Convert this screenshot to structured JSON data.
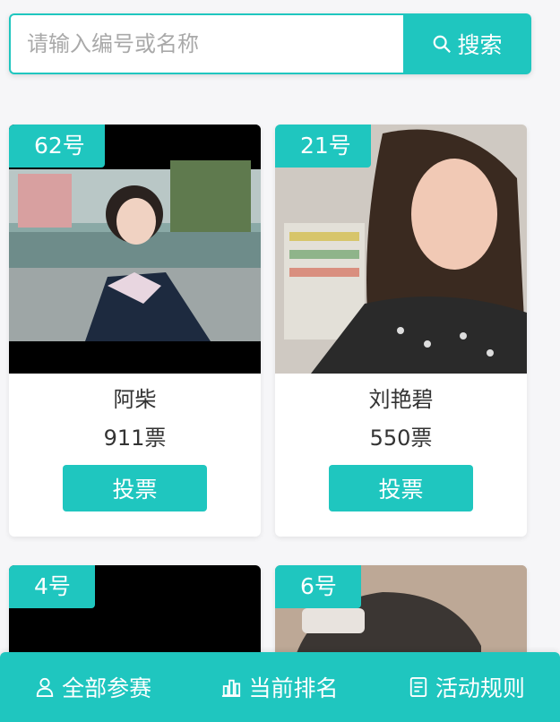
{
  "search": {
    "placeholder": "请输入编号或名称",
    "button_label": "搜索",
    "icon": "search-icon"
  },
  "theme": {
    "accent": "#1fc6bf"
  },
  "contestants": [
    {
      "badge": "62号",
      "name": "阿柴",
      "votes": "911票",
      "vote_label": "投票"
    },
    {
      "badge": "21号",
      "name": "刘艳碧",
      "votes": "550票",
      "vote_label": "投票"
    },
    {
      "badge": "4号"
    },
    {
      "badge": "6号"
    }
  ],
  "bottom_nav": [
    {
      "label": "全部参赛",
      "icon": "person-icon"
    },
    {
      "label": "当前排名",
      "icon": "bar-chart-icon"
    },
    {
      "label": "活动规则",
      "icon": "document-icon"
    }
  ]
}
